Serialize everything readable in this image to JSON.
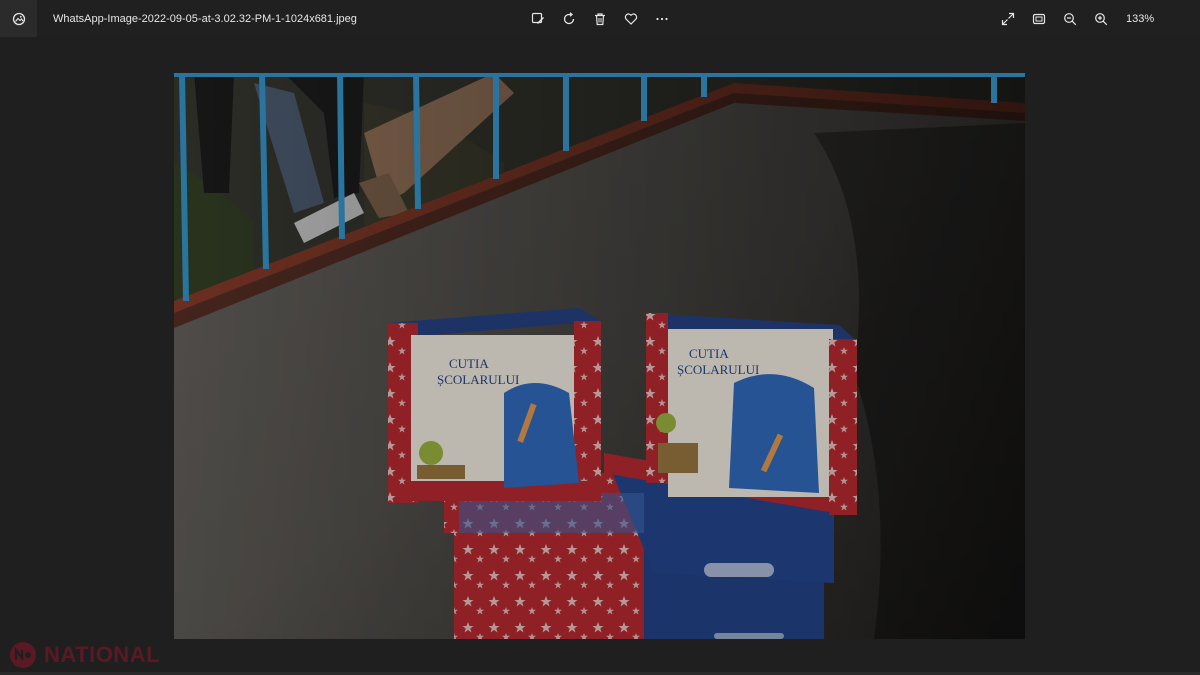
{
  "window": {
    "filename": "WhatsApp-Image-2022-09-05-at-3.02.32-PM-1-1024x681.jpeg",
    "zoom_level": "133%"
  },
  "toolbar": {
    "center_icons": [
      "edit-image-icon",
      "rotate-icon",
      "delete-icon",
      "favorite-icon",
      "more-icon"
    ],
    "right_icons": [
      "fullscreen-icon",
      "fit-to-window-icon",
      "zoom-out-icon",
      "zoom-in-icon"
    ]
  },
  "photo": {
    "box_title_line1": "CUTIA",
    "box_title_line2": "ȘCOLARULUI"
  },
  "watermark": {
    "text": "NATIONAL"
  },
  "colors": {
    "background": "#1f1f1f",
    "titlebar": "#202020",
    "watermark": "#c8102e"
  }
}
